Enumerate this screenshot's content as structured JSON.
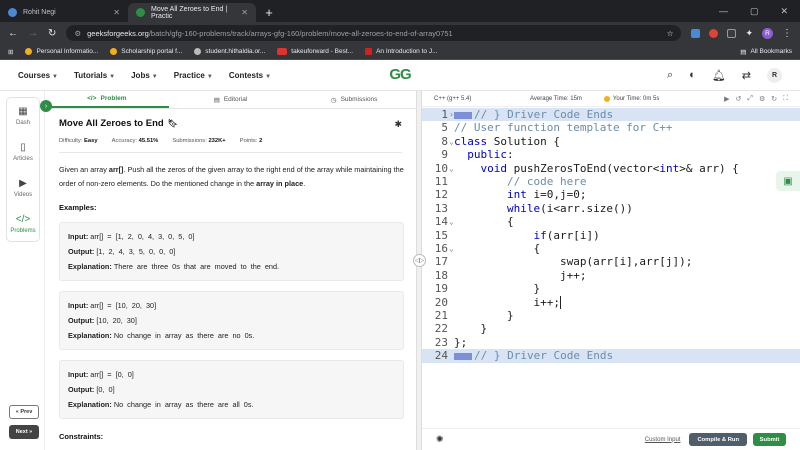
{
  "browser": {
    "tabs": [
      {
        "title": "Rohit Negi",
        "active": false
      },
      {
        "title": "Move All Zeroes to End | Practic",
        "active": true
      }
    ],
    "url_host": "geeksforgeeks.org",
    "url_path": "/batch/gfg-160-problems/track/arrays-gfg-160/problem/move-all-zeroes-to-end-of-array0751",
    "profile_initial": "R",
    "bookmarks": [
      "Personal Informatio...",
      "Scholarship portal f...",
      "student.hithaldia.or...",
      "takeuforward - Best...",
      "An Introduction to J..."
    ],
    "all_bookmarks": "All Bookmarks"
  },
  "site": {
    "nav": [
      "Courses",
      "Tutorials",
      "Jobs",
      "Practice",
      "Contests"
    ],
    "logo": "GG",
    "user_initial": "R"
  },
  "rail": {
    "items": [
      "Dash",
      "Articles",
      "Videos",
      "Problems"
    ],
    "prev": "« Prev",
    "next": "Next »"
  },
  "problem": {
    "tabs": [
      "Problem",
      "Editorial",
      "Submissions"
    ],
    "title": "Move All Zeroes to End",
    "difficulty_label": "Difficulty:",
    "difficulty": "Easy",
    "accuracy_label": "Accuracy:",
    "accuracy": "45.51%",
    "submissions_label": "Submissions:",
    "submissions": "232K+",
    "points_label": "Points:",
    "points": "2",
    "desc_1": "Given an array ",
    "desc_arr": "arr[]",
    "desc_2": ". Push all the zeros of the given array to the right end of the array while maintaining the order of non-zero elements. Do the mentioned change in the ",
    "desc_place": "array in place",
    "desc_3": ".",
    "examples_heading": "Examples:",
    "examples": [
      {
        "input": "arr[] = [1, 2, 0, 4, 3, 0, 5, 0]",
        "output": "[1, 2, 4, 3, 5, 0, 0, 0]",
        "explanation": "There are three 0s that are moved to the end."
      },
      {
        "input": "arr[] = [10, 20, 30]",
        "output": "[10, 20, 30]",
        "explanation": "No change in array as there are no 0s."
      },
      {
        "input": "arr[] = [0, 0]",
        "output": "[0, 0]",
        "explanation": "No change in array as there are all 0s."
      }
    ],
    "input_label": "Input:",
    "output_label": "Output:",
    "explanation_label": "Explanation:",
    "constraints_heading": "Constraints:"
  },
  "editor": {
    "language": "C++ (g++ 5.4)",
    "avg_time": "Average Time: 15m",
    "your_time": "Your Time: 0m 5s",
    "custom_input": "Custom Input",
    "compile_run": "Compile & Run",
    "submit": "Submit",
    "lines": [
      {
        "n": "1",
        "text": "// } Driver Code Ends"
      },
      {
        "n": "5",
        "text": "// User function template for C++"
      },
      {
        "n": "8",
        "text": "class Solution {"
      },
      {
        "n": "9",
        "text": "  public:"
      },
      {
        "n": "10",
        "text": "    void pushZerosToEnd(vector<int>& arr) {"
      },
      {
        "n": "11",
        "text": "        // code here"
      },
      {
        "n": "12",
        "text": "        int i=0,j=0;"
      },
      {
        "n": "13",
        "text": "        while(i<arr.size())"
      },
      {
        "n": "14",
        "text": "        {"
      },
      {
        "n": "15",
        "text": "            if(arr[i])"
      },
      {
        "n": "16",
        "text": "            {"
      },
      {
        "n": "17",
        "text": "                swap(arr[i],arr[j]);"
      },
      {
        "n": "18",
        "text": "                j++;"
      },
      {
        "n": "19",
        "text": "            }"
      },
      {
        "n": "20",
        "text": "            i++;"
      },
      {
        "n": "21",
        "text": "        }"
      },
      {
        "n": "22",
        "text": "    }"
      },
      {
        "n": "23",
        "text": "};"
      },
      {
        "n": "24",
        "text": "// } Driver Code Ends"
      }
    ]
  }
}
